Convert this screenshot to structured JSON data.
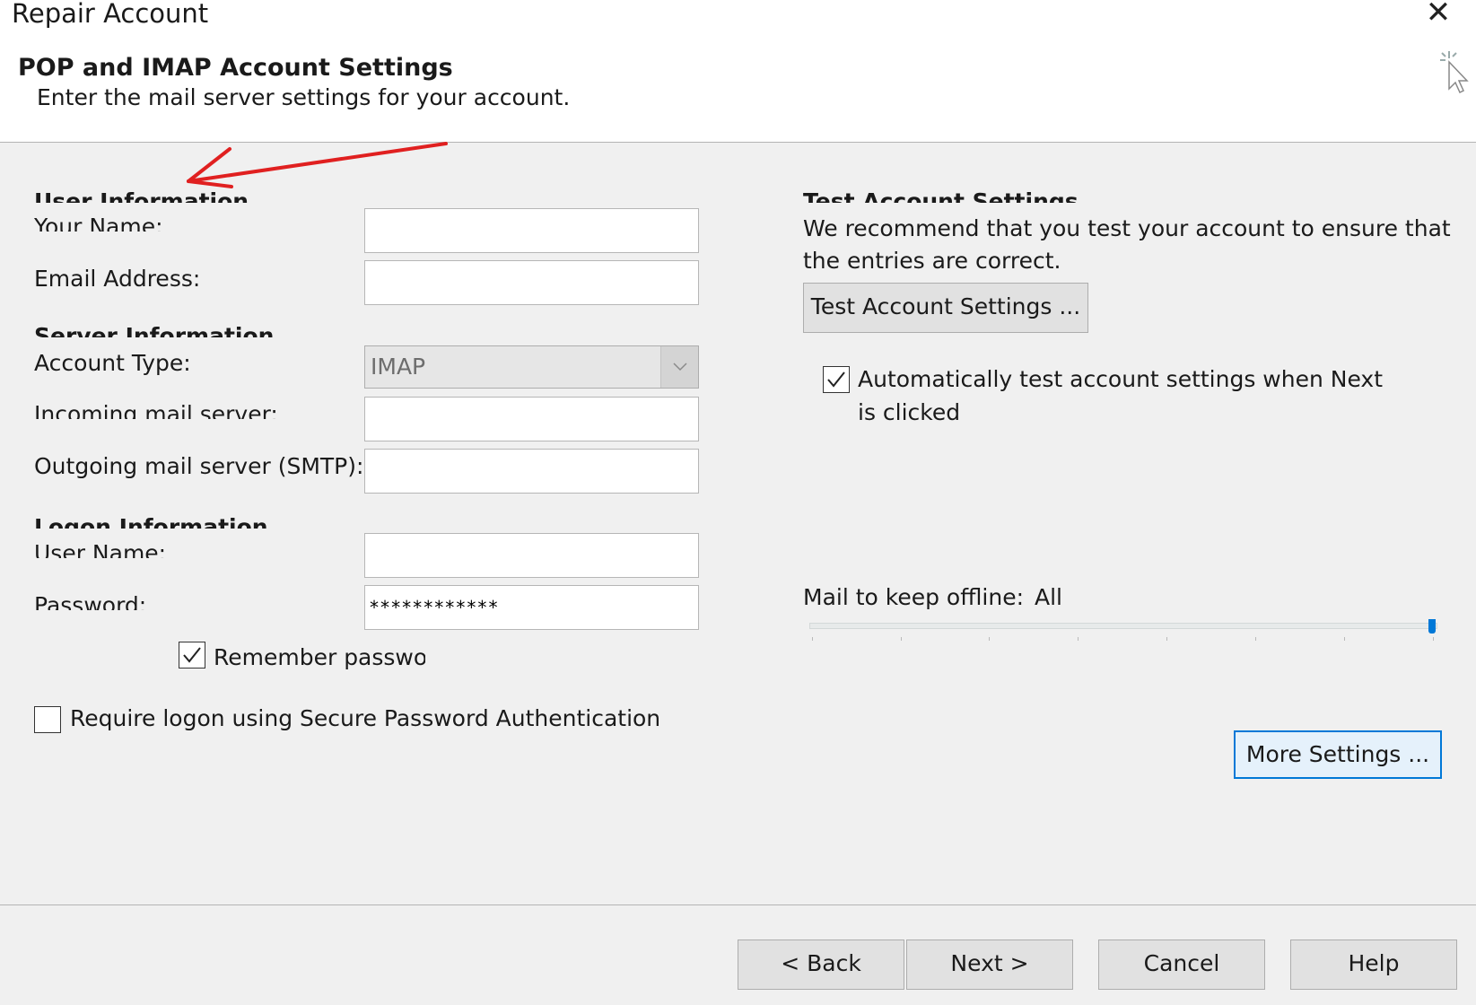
{
  "window": {
    "title": "Repair Account",
    "close_icon": "close-icon"
  },
  "header": {
    "title": "POP and IMAP Account Settings",
    "subtitle": "Enter the mail server settings for your account."
  },
  "user_info": {
    "heading": "User Information",
    "your_name_label": "Your Name:",
    "your_name_value": "",
    "email_label": "Email Address:",
    "email_value": ""
  },
  "server_info": {
    "heading": "Server Information",
    "account_type_label": "Account Type:",
    "account_type_value": "IMAP",
    "incoming_label": "Incoming mail server:",
    "incoming_value": "",
    "outgoing_label": "Outgoing mail server (SMTP):",
    "outgoing_value": ""
  },
  "logon_info": {
    "heading": "Logon Information",
    "user_name_label": "User Name:",
    "user_name_value": "",
    "password_label": "Password:",
    "password_value": "************",
    "remember_label": "Remember passwor",
    "remember_checked": true,
    "spa_label": "Require logon using Secure Password Authentication",
    "spa_checked": false
  },
  "test_settings": {
    "heading": "Test Account Settings",
    "line1": "We recommend that you test your account to ensure that",
    "line2": "the entries are correct.",
    "button": "Test Account Settings ...",
    "auto_line1": "Automatically test account settings when Next",
    "auto_line2": "is clicked",
    "auto_checked": true
  },
  "offline": {
    "label": "Mail to keep offline:",
    "value": "All",
    "slider_level": 1.0
  },
  "more_settings_button": "More Settings ...",
  "footer": {
    "back": "< Back",
    "next": "Next >",
    "cancel": "Cancel",
    "help": "Help"
  },
  "colors": {
    "accent": "#0078d7",
    "annotation": "#e02020",
    "background": "#f0f0f0"
  }
}
